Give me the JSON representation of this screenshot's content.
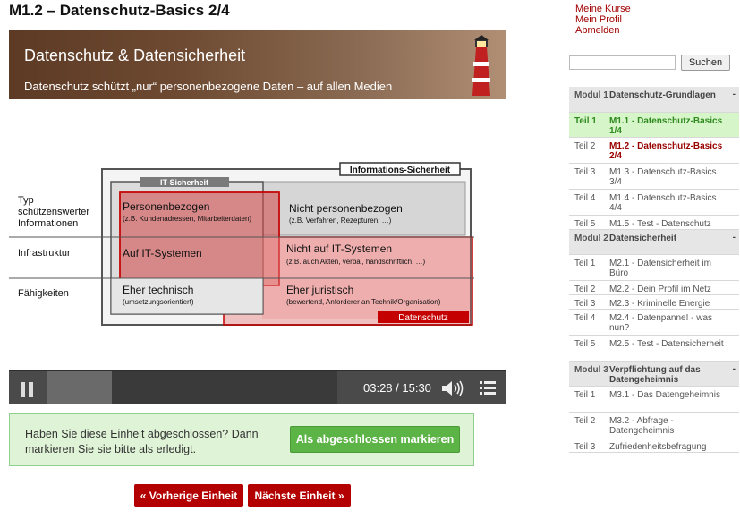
{
  "page": {
    "title": "M1.2 – Datenschutz-Basics 2/4"
  },
  "video": {
    "banner_title": "Datenschutz & Datensicherheit",
    "banner_subtitle": "Datenschutz schützt „nur“ personenbezogene Daten – auf allen Medien",
    "slide": {
      "label_info_security": "Informations-Sicherheit",
      "label_it_security": "IT-Sicherheit",
      "label_data_protection": "Datenschutz",
      "row_labels": [
        "Typ",
        "schützenswerter",
        "Informationen",
        "Infrastruktur",
        "Fähigkeiten"
      ],
      "cells": {
        "personal_title": "Personenbezogen",
        "personal_sub": "(z.B. Kundenadressen, Mitarbeiterdaten)",
        "nonpersonal_title": "Nicht personenbezogen",
        "nonpersonal_sub": "(z.B. Verfahren, Rezepturen, …)",
        "onit_title": "Auf IT-Systemen",
        "notit_title": "Nicht auf IT-Systemen",
        "notit_sub": "(z.B. auch Akten, verbal, handschriftlich, …)",
        "tech_title": "Eher technisch",
        "tech_sub": "(umsetzungsorientiert)",
        "legal_title": "Eher juristisch",
        "legal_sub": "(bewertend, Anforderer an Technik/Organisation)"
      }
    },
    "time_display": "03:28 / 15:30",
    "progress_fraction": 0.226,
    "icons": {
      "pause": "pause-icon",
      "volume": "volume-icon",
      "menu": "menu-icon"
    }
  },
  "completion": {
    "text": "Haben Sie diese Einheit abgeschlossen? Dann markieren Sie sie bitte als erledigt.",
    "button": "Als abgeschlossen markieren"
  },
  "nav": {
    "prev": "« Vorherige Einheit",
    "next": "Nächste Einheit »"
  },
  "user_menu": [
    "Meine Kurse",
    "Mein Profil",
    "Abmelden"
  ],
  "search": {
    "placeholder": "",
    "button": "Suchen"
  },
  "sidebar": [
    {
      "type": "module",
      "c1": "Modul 1",
      "c2": "Datenschutz-Grundlagen",
      "toggle": "-"
    },
    {
      "type": "lesson",
      "state": "current",
      "c1": "Teil 1",
      "c2": "M1.1 - Datenschutz-Basics 1/4"
    },
    {
      "type": "lesson",
      "state": "active",
      "c1": "Teil 2",
      "c2": "M1.2 - Datenschutz-Basics 2/4"
    },
    {
      "type": "lesson",
      "c1": "Teil 3",
      "c2": "M1.3 - Datenschutz-Basics 3/4"
    },
    {
      "type": "lesson",
      "c1": "Teil 4",
      "c2": "M1.4 - Datenschutz-Basics 4/4"
    },
    {
      "type": "lesson",
      "c1": "Teil 5",
      "c2": "M1.5 - Test - Datenschutz"
    },
    {
      "type": "module",
      "c1": "Modul 2",
      "c2": "Datensicherheit",
      "toggle": "-"
    },
    {
      "type": "lesson",
      "c1": "Teil 1",
      "c2": "M2.1 - Datensicherheit im Büro"
    },
    {
      "type": "lesson",
      "c1": "Teil 2",
      "c2": "M2.2 - Dein Profil im Netz"
    },
    {
      "type": "lesson",
      "c1": "Teil 3",
      "c2": "M2.3 - Kriminelle Energie"
    },
    {
      "type": "lesson",
      "c1": "Teil 4",
      "c2": "M2.4 - Datenpanne! - was nun?"
    },
    {
      "type": "lesson",
      "c1": "Teil 5",
      "c2": "M2.5 - Test - Datensicherheit"
    },
    {
      "type": "module",
      "c1": "Modul 3",
      "c2": "Verpflichtung auf das Datengeheimnis",
      "toggle": "-"
    },
    {
      "type": "lesson",
      "c1": "Teil 1",
      "c2": "M3.1 - Das Datengeheimnis"
    },
    {
      "type": "lesson",
      "c1": "Teil 2",
      "c2": "M3.2 - Abfrage - Datengeheimnis"
    },
    {
      "type": "lesson",
      "c1": "Teil 3",
      "c2": "Zufriedenheitsbefragung"
    }
  ]
}
